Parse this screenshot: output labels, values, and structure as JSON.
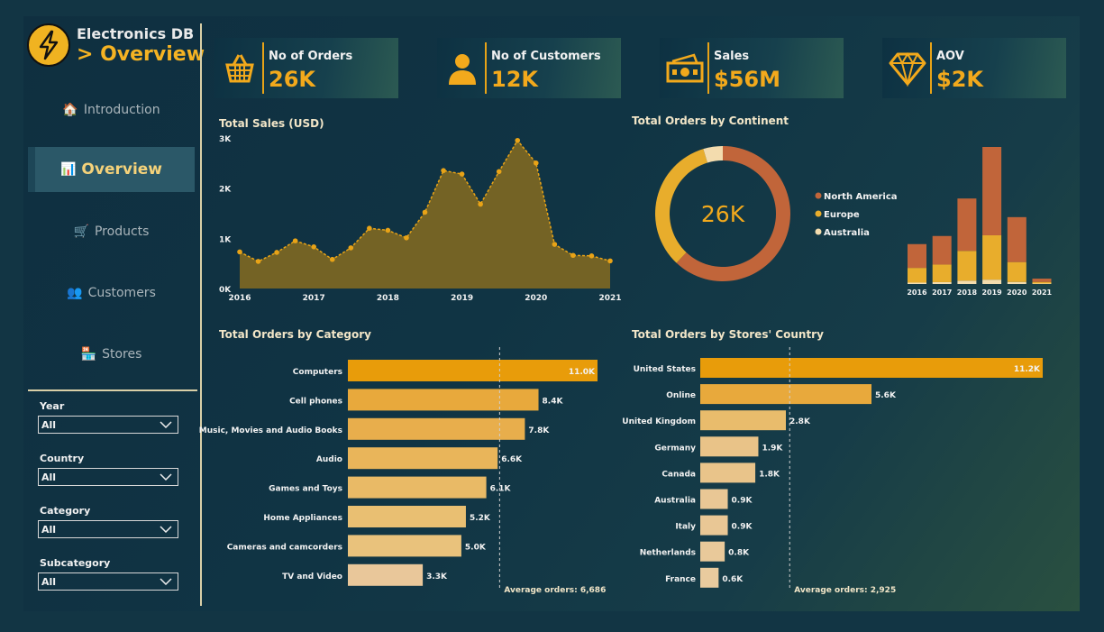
{
  "app": {
    "title": "Electronics DB",
    "subtitle": "> Overview"
  },
  "nav": [
    {
      "label": "Introduction",
      "icon": "🏠",
      "active": false
    },
    {
      "label": "Overview",
      "icon": "📊",
      "active": true
    },
    {
      "label": "Products",
      "icon": "🛒",
      "active": false
    },
    {
      "label": "Customers",
      "icon": "👥",
      "active": false
    },
    {
      "label": "Stores",
      "icon": "🏪",
      "active": false
    }
  ],
  "filters": [
    {
      "label": "Year",
      "value": "All"
    },
    {
      "label": "Country",
      "value": "All"
    },
    {
      "label": "Category",
      "value": "All"
    },
    {
      "label": "Subcategory",
      "value": "All"
    }
  ],
  "kpis": [
    {
      "label": "No of Orders",
      "value": "26K",
      "icon": "basket-icon"
    },
    {
      "label": "No of Customers",
      "value": "12K",
      "icon": "person-icon"
    },
    {
      "label": "Sales",
      "value": "$56M",
      "icon": "cash-icon"
    },
    {
      "label": "AOV",
      "value": "$2K",
      "icon": "diamond-icon"
    }
  ],
  "colors": {
    "accent": "#f2a91c",
    "north_america": "#c1653a",
    "europe": "#e8ad2c",
    "australia": "#f3dcae",
    "area": "#7a6624",
    "area_line": "#e8a317",
    "bar_top": "#e89c0a",
    "bar_mid": "#e8ad45",
    "bar_light": "#e9c79a"
  },
  "chart_data": [
    {
      "type": "area",
      "title": "Total Sales (USD)",
      "x_ticks": [
        "2016",
        "2017",
        "2018",
        "2019",
        "2020",
        "2021"
      ],
      "y_ticks": [
        "0K",
        "1K",
        "2K",
        "3K"
      ],
      "ylim": [
        0,
        3000
      ],
      "x": [
        "2016-01",
        "2016-04",
        "2016-07",
        "2016-10",
        "2017-01",
        "2017-04",
        "2017-07",
        "2017-10",
        "2018-01",
        "2018-04",
        "2018-07",
        "2018-10",
        "2019-01",
        "2019-04",
        "2019-07",
        "2019-10",
        "2020-01",
        "2020-04",
        "2020-07",
        "2020-10",
        "2021-01"
      ],
      "values": [
        730,
        540,
        720,
        950,
        830,
        580,
        810,
        1200,
        1160,
        1010,
        1520,
        2350,
        2280,
        1680,
        2330,
        2950,
        2500,
        880,
        660,
        650,
        550
      ]
    },
    {
      "type": "pie",
      "title": "Total Orders by Continent",
      "center_label": "26K",
      "categories": [
        "North America",
        "Europe",
        "Australia"
      ],
      "values": [
        16000,
        8600,
        1200
      ],
      "legend": "right"
    },
    {
      "type": "bar",
      "stacked": true,
      "categories": [
        "2016",
        "2017",
        "2018",
        "2019",
        "2020",
        "2021"
      ],
      "series": [
        {
          "name": "Australia",
          "values": [
            120,
            160,
            290,
            380,
            180,
            40
          ]
        },
        {
          "name": "Europe",
          "values": [
            1290,
            1540,
            2610,
            3880,
            1740,
            140
          ]
        },
        {
          "name": "North America",
          "values": [
            2080,
            2500,
            4580,
            7730,
            3930,
            290
          ]
        }
      ]
    },
    {
      "type": "bar",
      "orientation": "horizontal",
      "title": "Total Orders by Category",
      "categories": [
        "Computers",
        "Cell phones",
        "Music, Movies and Audio Books",
        "Audio",
        "Games and Toys",
        "Home Appliances",
        "Cameras and camcorders",
        "TV and Video"
      ],
      "values": [
        11000,
        8400,
        7800,
        6600,
        6100,
        5200,
        5000,
        3300
      ],
      "labels": [
        "11.0K",
        "8.4K",
        "7.8K",
        "6.6K",
        "6.1K",
        "5.2K",
        "5.0K",
        "3.3K"
      ],
      "average": 6686,
      "average_label": "Average orders: 6,686"
    },
    {
      "type": "bar",
      "orientation": "horizontal",
      "title": "Total Orders by Stores' Country",
      "categories": [
        "United States",
        "Online",
        "United Kingdom",
        "Germany",
        "Canada",
        "Australia",
        "Italy",
        "Netherlands",
        "France"
      ],
      "values": [
        11200,
        5600,
        2800,
        1900,
        1800,
        900,
        900,
        800,
        600
      ],
      "labels": [
        "11.2K",
        "5.6K",
        "2.8K",
        "1.9K",
        "1.8K",
        "0.9K",
        "0.9K",
        "0.8K",
        "0.6K"
      ],
      "average": 2925,
      "average_label": "Average orders: 2,925"
    }
  ]
}
